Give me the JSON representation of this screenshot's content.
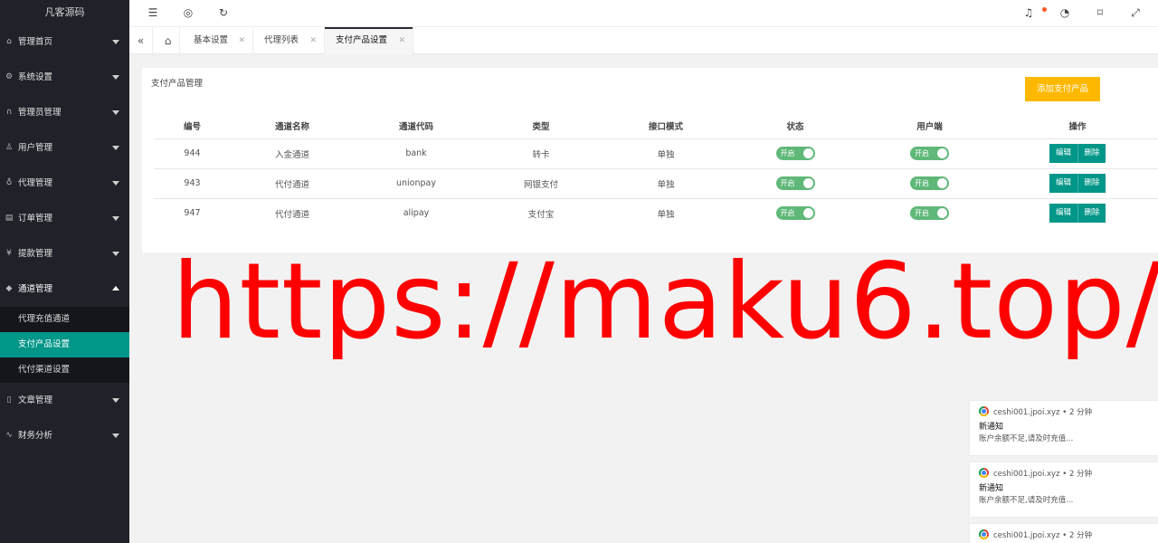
{
  "sidebar": {
    "logo": "凡客源码",
    "items": [
      {
        "label": "管理首页",
        "icon": "home-icon",
        "glyph": "⌂"
      },
      {
        "label": "系统设置",
        "icon": "gear-icon",
        "glyph": "⚙"
      },
      {
        "label": "管理员管理",
        "icon": "headset-icon",
        "glyph": "∩"
      },
      {
        "label": "用户管理",
        "icon": "user-icon",
        "glyph": "♙"
      },
      {
        "label": "代理管理",
        "icon": "flask-icon",
        "glyph": "♁"
      },
      {
        "label": "订单管理",
        "icon": "list-icon",
        "glyph": "▤"
      },
      {
        "label": "提款管理",
        "icon": "yen-icon",
        "glyph": "¥"
      },
      {
        "label": "通道管理",
        "icon": "diamond-icon",
        "glyph": "◆"
      }
    ],
    "channel_sub": [
      "代理充值通道",
      "支付产品设置",
      "代付渠道设置"
    ],
    "items_after": [
      {
        "label": "文章管理",
        "icon": "document-icon",
        "glyph": "▯"
      },
      {
        "label": "财务分析",
        "icon": "pulse-icon",
        "glyph": "∿"
      }
    ]
  },
  "tabs": [
    {
      "label": "基本设置"
    },
    {
      "label": "代理列表"
    },
    {
      "label": "支付产品设置",
      "active": true
    }
  ],
  "card": {
    "title": "支付产品管理",
    "add_button": "添加支付产品"
  },
  "table": {
    "columns": [
      "编号",
      "通道名称",
      "通道代码",
      "类型",
      "接口模式",
      "状态",
      "用户端",
      "操作"
    ],
    "rows": [
      {
        "id": "944",
        "name": "入金通道",
        "code": "bank",
        "type": "转卡",
        "mode": "单独",
        "status": "开启",
        "client": "开启"
      },
      {
        "id": "943",
        "name": "代付通道",
        "code": "unionpay",
        "type": "网银支付",
        "mode": "单独",
        "status": "开启",
        "client": "开启"
      },
      {
        "id": "947",
        "name": "代付通道",
        "code": "alipay",
        "type": "支付宝",
        "mode": "单独",
        "status": "开启",
        "client": "开启"
      }
    ],
    "edit_label": "编辑",
    "delete_label": "删除"
  },
  "watermark": "https://maku6.top/",
  "notifications": [
    {
      "source": "ceshi001.jpoi.xyz",
      "time": "2 分钟",
      "title": "新通知",
      "body": "账户余额不足,请及时充值..."
    },
    {
      "source": "ceshi001.jpoi.xyz",
      "time": "2 分钟",
      "title": "新通知",
      "body": "账户余额不足,请及时充值..."
    },
    {
      "source": "ceshi001.jpoi.xyz",
      "time": "2 分钟"
    }
  ],
  "colors": {
    "accent": "#009688",
    "warning": "#ffb800",
    "switch_on": "#5fb878",
    "sidebar_bg": "#20222a",
    "watermark": "#ff0000"
  }
}
